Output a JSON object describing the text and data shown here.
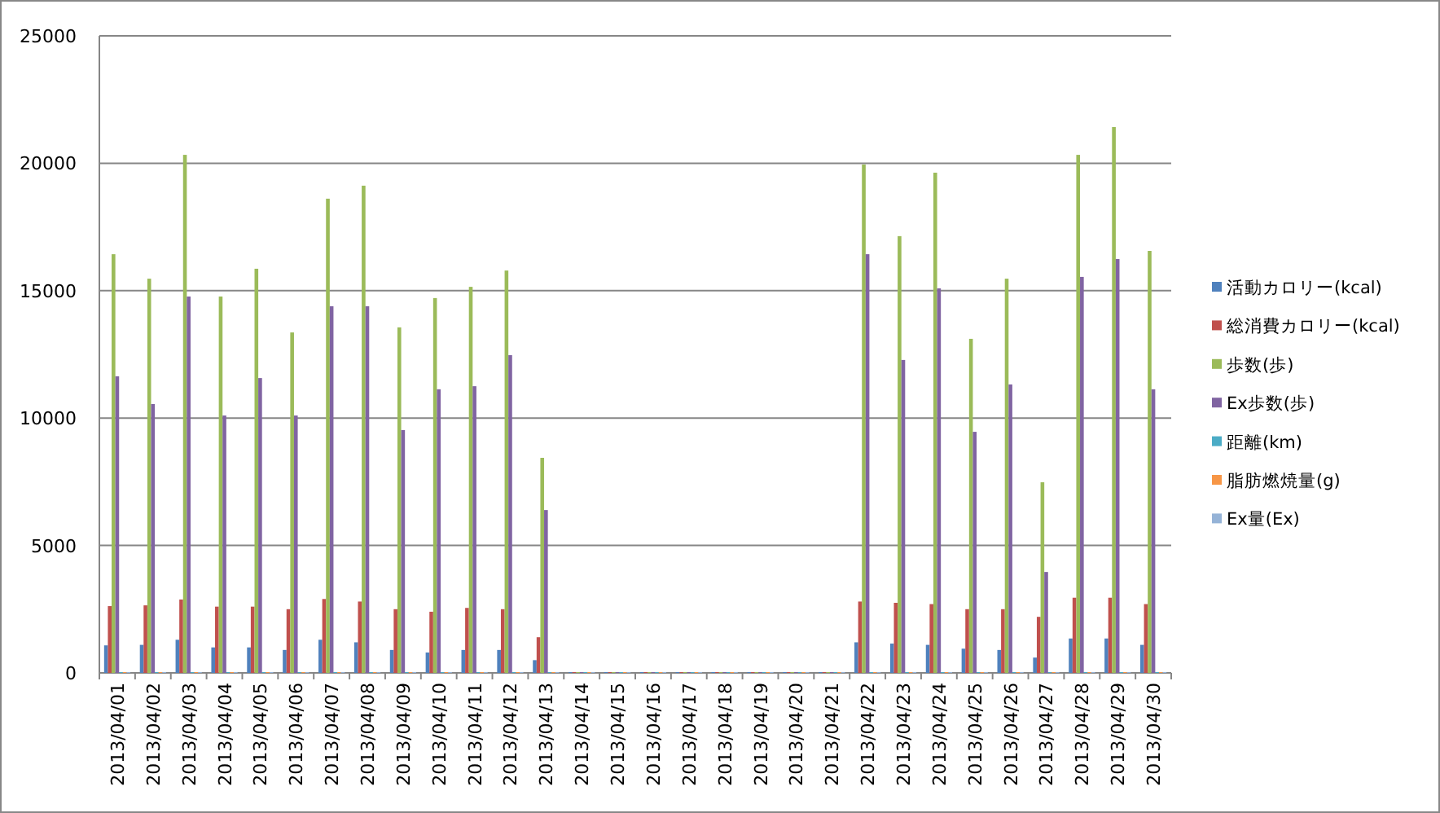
{
  "chart_data": {
    "type": "bar",
    "grid": true,
    "legend": true,
    "categories": [
      "2013/04/01",
      "2013/04/02",
      "2013/04/03",
      "2013/04/04",
      "2013/04/05",
      "2013/04/06",
      "2013/04/07",
      "2013/04/08",
      "2013/04/09",
      "2013/04/10",
      "2013/04/11",
      "2013/04/12",
      "2013/04/13",
      "2013/04/14",
      "2013/04/15",
      "2013/04/16",
      "2013/04/17",
      "2013/04/18",
      "2013/04/19",
      "2013/04/20",
      "2013/04/21",
      "2013/04/22",
      "2013/04/23",
      "2013/04/24",
      "2013/04/25",
      "2013/04/26",
      "2013/04/27",
      "2013/04/28",
      "2013/04/29",
      "2013/04/30"
    ],
    "ylim": [
      0,
      25000
    ],
    "yticks": [
      0,
      5000,
      10000,
      15000,
      20000,
      25000
    ],
    "series": [
      {
        "name": "活動カロリー(kcal)",
        "color": "#4f81bd",
        "values": [
          1080,
          1100,
          1300,
          1000,
          1000,
          900,
          1300,
          1200,
          900,
          800,
          900,
          900,
          500,
          0,
          0,
          0,
          0,
          0,
          0,
          0,
          0,
          1200,
          1150,
          1100,
          950,
          900,
          600,
          1350,
          1350,
          1100
        ]
      },
      {
        "name": "総消費カロリー(kcal)",
        "color": "#c0504d",
        "values": [
          2620,
          2650,
          2880,
          2600,
          2600,
          2500,
          2900,
          2800,
          2500,
          2400,
          2550,
          2500,
          1400,
          0,
          0,
          0,
          0,
          0,
          0,
          0,
          0,
          2800,
          2750,
          2700,
          2500,
          2500,
          2200,
          2950,
          2950,
          2700
        ]
      },
      {
        "name": "歩数(歩)",
        "color": "#9bbb59",
        "values": [
          16430,
          15470,
          20330,
          14770,
          15860,
          13360,
          18610,
          19120,
          13560,
          14710,
          15150,
          15790,
          8440,
          0,
          0,
          0,
          0,
          0,
          0,
          0,
          0,
          19950,
          17140,
          19630,
          13110,
          15470,
          7480,
          20330,
          21420,
          16560
        ]
      },
      {
        "name": "Ex歩数(歩)",
        "color": "#8064a2",
        "values": [
          11640,
          10550,
          14770,
          10100,
          11570,
          10100,
          14390,
          14390,
          9530,
          11130,
          11250,
          12470,
          6390,
          0,
          0,
          0,
          0,
          0,
          0,
          0,
          0,
          16430,
          12280,
          15090,
          9460,
          11320,
          3960,
          15540,
          16240,
          11130
        ]
      },
      {
        "name": "距離(km)",
        "color": "#4bacc6",
        "values": [
          0,
          0,
          0,
          0,
          0,
          0,
          0,
          0,
          0,
          0,
          0,
          0,
          0,
          0,
          0,
          0,
          0,
          0,
          0,
          0,
          0,
          0,
          0,
          0,
          0,
          0,
          0,
          0,
          0,
          0
        ]
      },
      {
        "name": "脂肪燃焼量(g)",
        "color": "#f79646",
        "values": [
          0,
          0,
          0,
          0,
          0,
          0,
          0,
          0,
          0,
          0,
          0,
          0,
          0,
          0,
          0,
          0,
          0,
          0,
          0,
          0,
          0,
          0,
          0,
          0,
          0,
          0,
          0,
          0,
          0,
          0
        ]
      },
      {
        "name": "Ex量(Ex)",
        "color": "#95b3d7",
        "values": [
          0,
          0,
          0,
          0,
          0,
          0,
          0,
          0,
          0,
          0,
          0,
          0,
          0,
          0,
          0,
          0,
          0,
          0,
          0,
          0,
          0,
          0,
          0,
          0,
          0,
          0,
          0,
          0,
          0,
          0
        ]
      }
    ]
  }
}
